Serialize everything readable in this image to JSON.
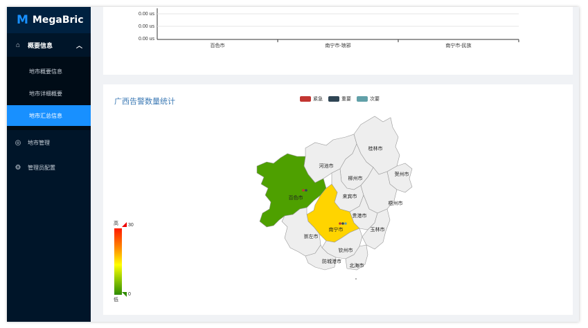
{
  "app": {
    "name": "MegaBric",
    "logo_letter": "M"
  },
  "sidebar": {
    "group": {
      "label": "概要信息",
      "icon": "home-icon",
      "expanded": true
    },
    "sub_items": [
      {
        "label": "地市概要信息",
        "active": false
      },
      {
        "label": "地市详细概要",
        "active": false
      },
      {
        "label": "地市汇总信息",
        "active": true
      }
    ],
    "items": [
      {
        "label": "地市管理",
        "icon": "location-icon"
      },
      {
        "label": "管理员配置",
        "icon": "gear-icon"
      }
    ]
  },
  "top_chart": {
    "y_ticks": [
      "0.00 us",
      "0.00 us",
      "0.00 us"
    ],
    "categories": [
      "百色市",
      "南宁市-琅邪",
      "南宁市-民族"
    ]
  },
  "map_card": {
    "title": "广西告警数量统计",
    "legend": [
      {
        "name": "紧急",
        "color": "#c23531"
      },
      {
        "name": "重要",
        "color": "#2f4554"
      },
      {
        "name": "次要",
        "color": "#61a0a8"
      }
    ],
    "visual_map": {
      "high_label": "高",
      "low_label": "低",
      "max": "30",
      "min": "0"
    },
    "regions": [
      {
        "name": "桂林市",
        "value": null
      },
      {
        "name": "河池市",
        "value": null
      },
      {
        "name": "柳州市",
        "value": null
      },
      {
        "name": "贺州市",
        "value": null
      },
      {
        "name": "百色市",
        "value": 5
      },
      {
        "name": "来宾市",
        "value": null
      },
      {
        "name": "梧州市",
        "value": null
      },
      {
        "name": "南宁市",
        "value": 20
      },
      {
        "name": "贵港市",
        "value": null
      },
      {
        "name": "玉林市",
        "value": null
      },
      {
        "name": "崇左市",
        "value": null
      },
      {
        "name": "钦州市",
        "value": null
      },
      {
        "name": "防城港市",
        "value": null
      },
      {
        "name": "北海市",
        "value": null
      }
    ],
    "colors": {
      "baise": "#4ea000",
      "nanning": "#ffd400",
      "default": "#eeeeee",
      "stroke": "#999999"
    }
  }
}
